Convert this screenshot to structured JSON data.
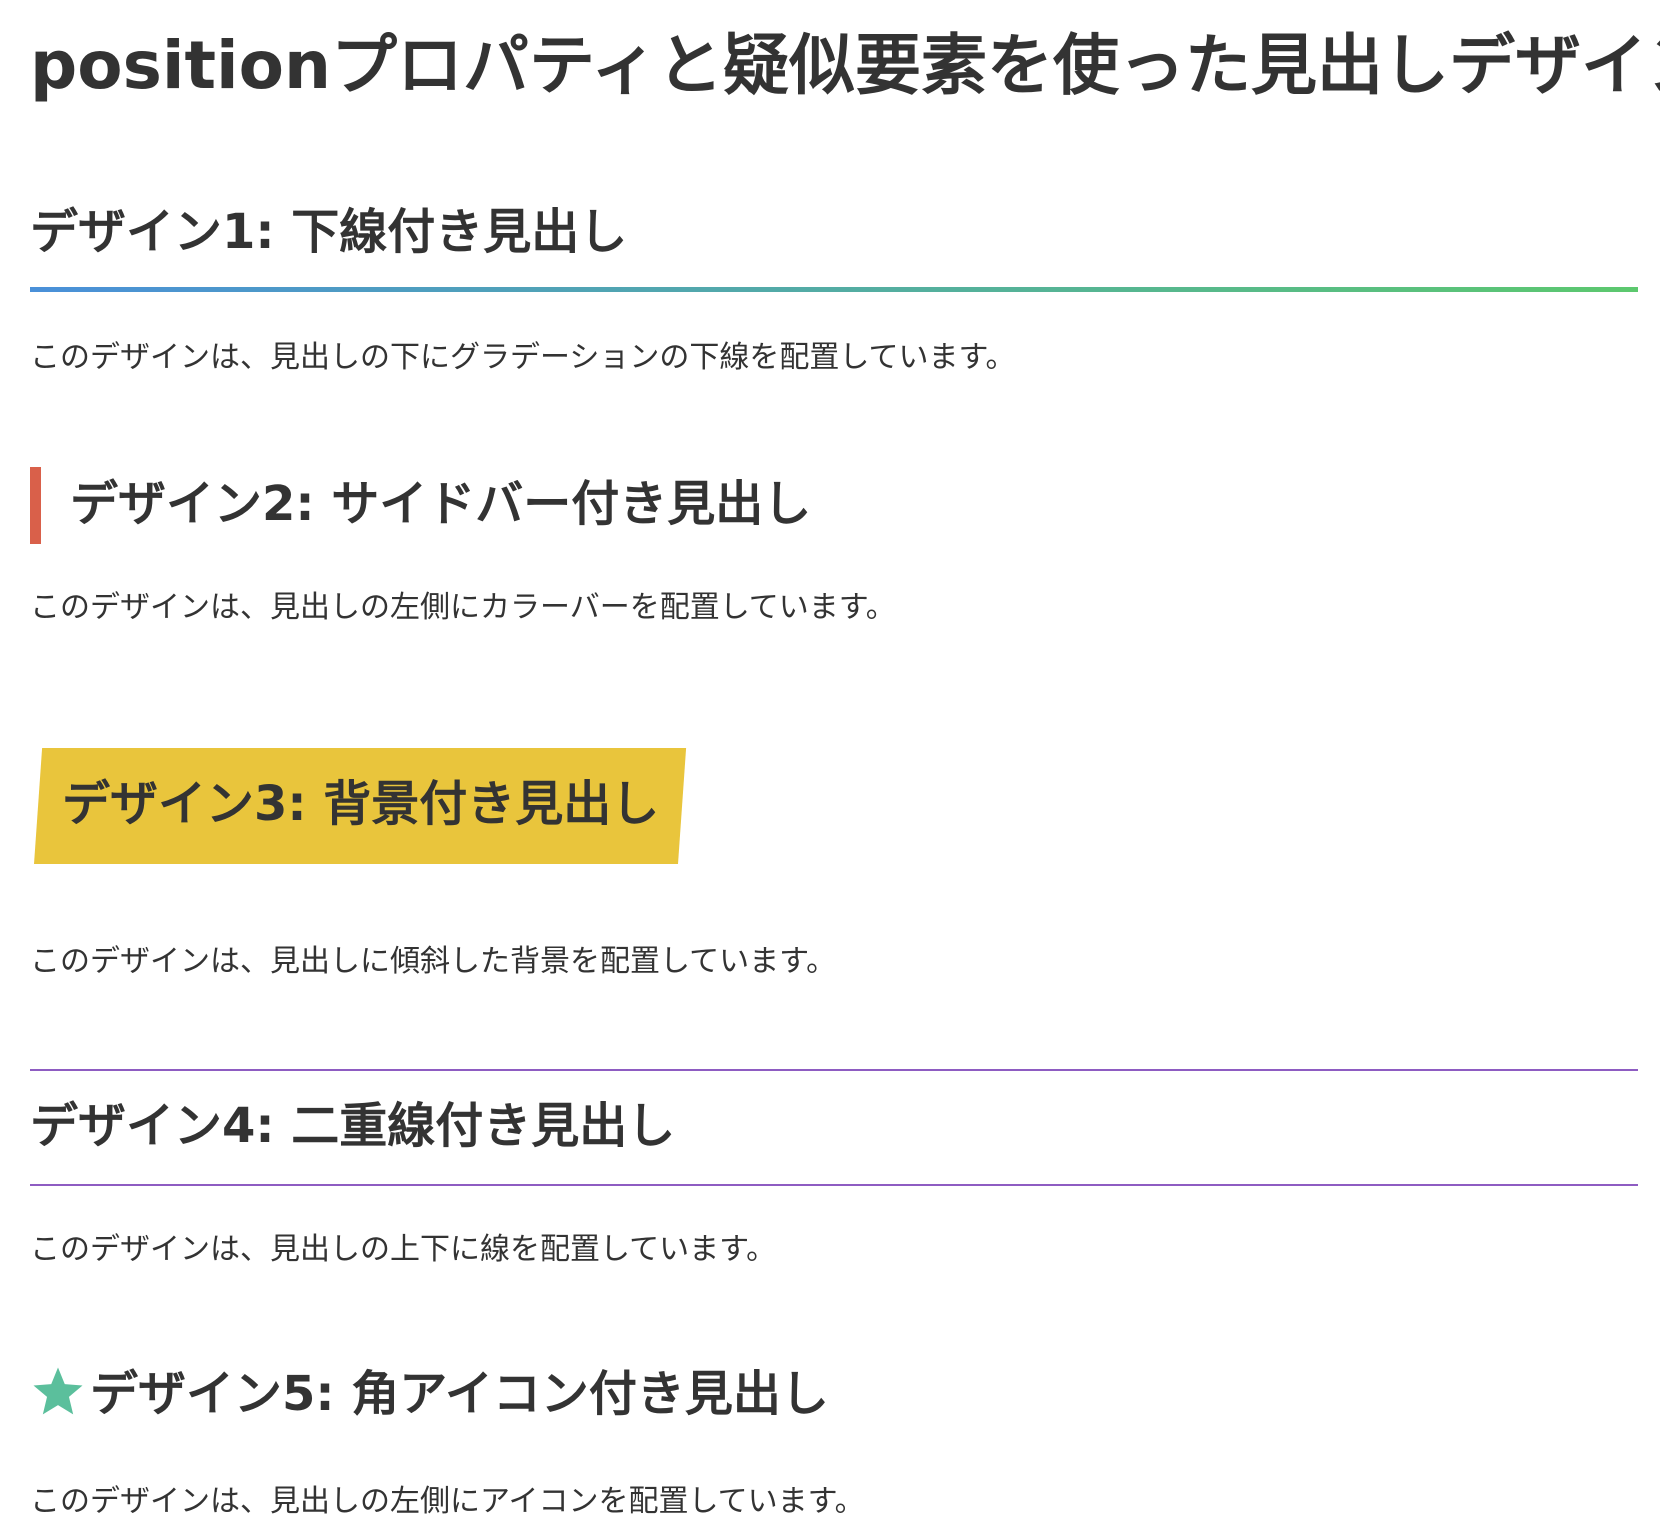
{
  "page": {
    "title": "positionプロパティと疑似要素を使った見出しデザイン"
  },
  "colors": {
    "text": "#333333",
    "gradient_start": "#4a90d9",
    "gradient_end": "#5cc86e",
    "sidebar": "#d9604a",
    "skew_background": "#e9c53c",
    "double_line": "#8e5cc2",
    "star": "#5bbf9c"
  },
  "sections": [
    {
      "heading": "デザイン1: 下線付き見出し",
      "description": "このデザインは、見出しの下にグラデーションの下線を配置しています。"
    },
    {
      "heading": "デザイン2: サイドバー付き見出し",
      "description": "このデザインは、見出しの左側にカラーバーを配置しています。"
    },
    {
      "heading": "デザイン3: 背景付き見出し",
      "description": "このデザインは、見出しに傾斜した背景を配置しています。"
    },
    {
      "heading": "デザイン4: 二重線付き見出し",
      "description": "このデザインは、見出しの上下に線を配置しています。"
    },
    {
      "heading": "デザイン5: 角アイコン付き見出し",
      "description": "このデザインは、見出しの左側にアイコンを配置しています。",
      "icon": "star-icon"
    }
  ]
}
